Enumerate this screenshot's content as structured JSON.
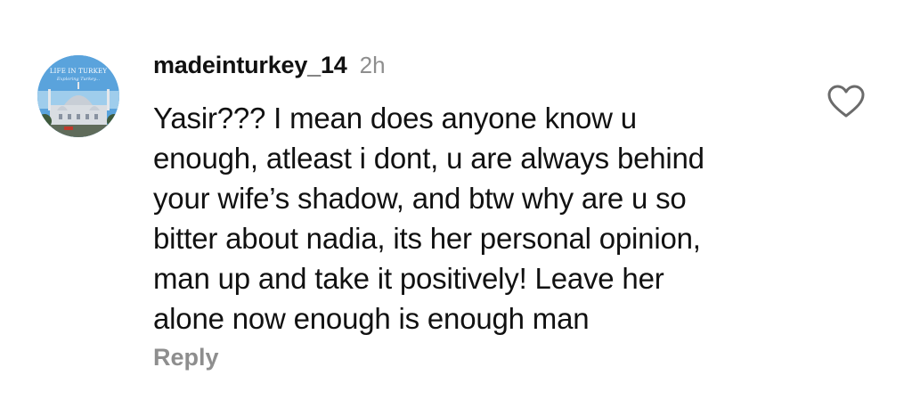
{
  "comment": {
    "avatar": {
      "line1": "LIFE IN TURKEY",
      "line2": "Exploring Turkey..."
    },
    "username": "madeinturkey_14",
    "time": "2h",
    "text_lines": [
      "Yasir??? I mean does anyone know u",
      "enough, atleast i dont, u are always behind",
      "your wife’s shadow, and btw why are u so",
      "bitter about nadia, its her personal opinion,",
      "man up and take it positively! Leave her",
      "alone now enough is enough man"
    ],
    "reply_label": "Reply",
    "like_icon": "heart-outline-icon"
  }
}
